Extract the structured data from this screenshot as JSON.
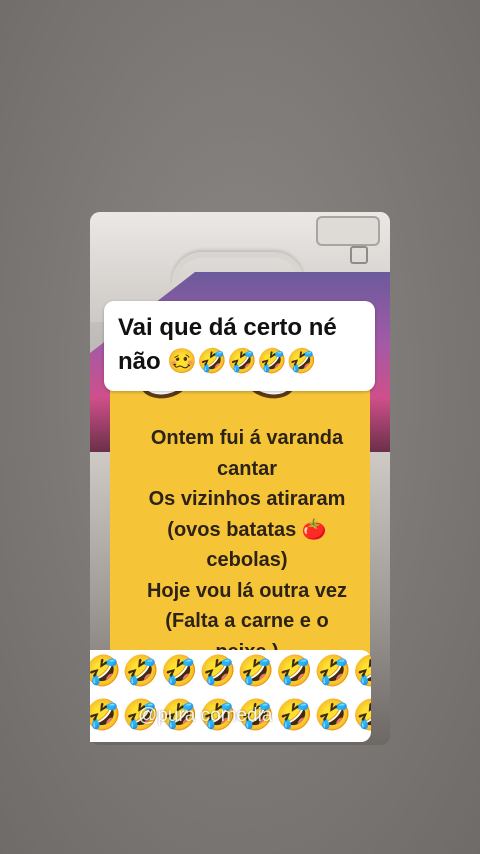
{
  "title": {
    "line1": "Vai que dá certo né",
    "line2": "não 🥴🤣🤣🤣🤣"
  },
  "joke": {
    "lines": [
      "Ontem fui á varanda",
      "cantar",
      "Os vizinhos atiraram",
      "(ovos batatas 🍅",
      "cebolas)",
      "Hoje vou lá outra vez",
      "(Falta a carne e o",
      "peixe )"
    ]
  },
  "emoji_bar": {
    "row1": "🤣🤣🤣🤣🤣🤣🤣🤣",
    "row2": "🤣🤣🤣🤣🤣🤣🤣🤣"
  },
  "watermark": "@pura comedia",
  "colors": {
    "background": "#7f7b79",
    "note_yellow": "#f6c537",
    "caption_bg": "#ffffff",
    "text_dark": "#111111"
  }
}
